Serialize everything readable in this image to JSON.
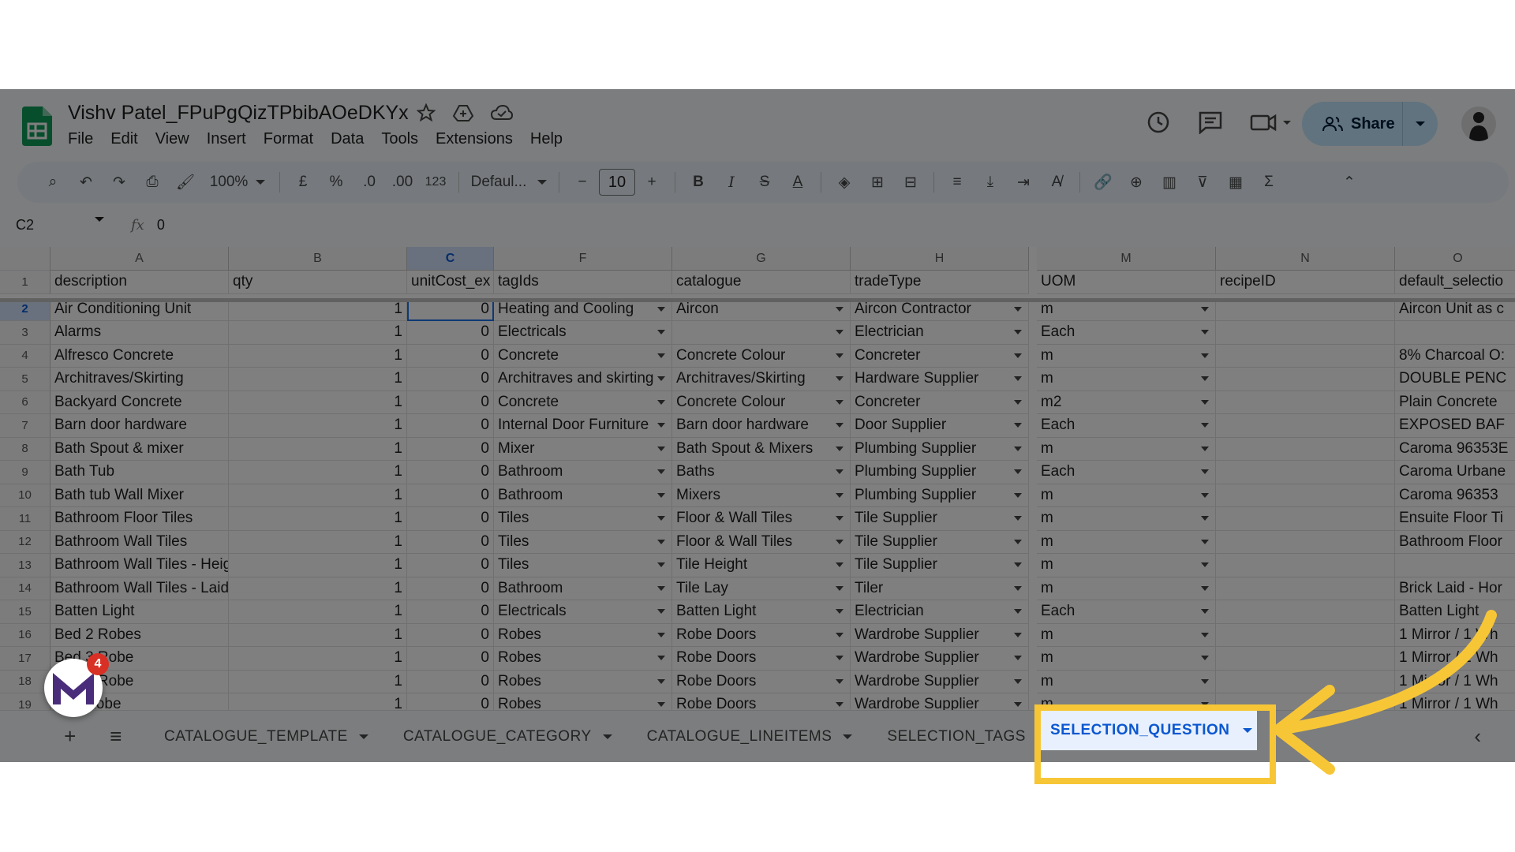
{
  "doc": {
    "title": "Vishv Patel_FPuPgQizTPbibAOeDKYx",
    "menu": [
      "File",
      "Edit",
      "View",
      "Insert",
      "Format",
      "Data",
      "Tools",
      "Extensions",
      "Help"
    ],
    "share_label": "Share"
  },
  "toolbar": {
    "zoom": "100%",
    "currency": "£",
    "percent": "%",
    "dec_decrease": ".0",
    "dec_increase": ".00",
    "number_format": "123",
    "font": "Defaul...",
    "font_size": "10"
  },
  "formula_bar": {
    "cell_ref": "C2",
    "fx": "fx",
    "value": "0"
  },
  "sheet": {
    "columns": [
      "A",
      "B",
      "C",
      "F",
      "G",
      "H",
      "M",
      "N",
      "O"
    ],
    "header_row": [
      "description",
      "qty",
      "unitCost_ex",
      "tagIds",
      "catalogue",
      "tradeType",
      "UOM",
      "recipeID",
      "default_selectio"
    ],
    "rows": [
      {
        "n": "2",
        "cells": [
          "Air Conditioning Unit",
          "1",
          "0",
          "Heating and Cooling",
          "Aircon",
          "Aircon Contractor",
          "m",
          "",
          "Aircon Unit as c"
        ]
      },
      {
        "n": "3",
        "cells": [
          "Alarms",
          "1",
          "0",
          "Electricals",
          "",
          "Electrician",
          "Each",
          "",
          ""
        ]
      },
      {
        "n": "4",
        "cells": [
          "Alfresco Concrete",
          "1",
          "0",
          "Concrete",
          "Concrete Colour",
          "Concreter",
          "m",
          "",
          "8% Charcoal O:"
        ]
      },
      {
        "n": "5",
        "cells": [
          "Architraves/Skirting",
          "1",
          "0",
          "Architraves and skirting",
          "Architraves/Skirting",
          "Hardware Supplier",
          "m",
          "",
          "DOUBLE PENC"
        ]
      },
      {
        "n": "6",
        "cells": [
          "Backyard Concrete",
          "1",
          "0",
          "Concrete",
          "Concrete Colour",
          "Concreter",
          "m2",
          "",
          "Plain Concrete"
        ]
      },
      {
        "n": "7",
        "cells": [
          "Barn door hardware",
          "1",
          "0",
          "Internal Door Furniture",
          "Barn door hardware",
          "Door Supplier",
          "Each",
          "",
          "EXPOSED BAF"
        ]
      },
      {
        "n": "8",
        "cells": [
          "Bath Spout & mixer",
          "1",
          "0",
          "Mixer",
          "Bath Spout & Mixers",
          "Plumbing Supplier",
          "m",
          "",
          "Caroma 96353E"
        ]
      },
      {
        "n": "9",
        "cells": [
          "Bath Tub",
          "1",
          "0",
          "Bathroom",
          "Baths",
          "Plumbing Supplier",
          "Each",
          "",
          "Caroma Urbane"
        ]
      },
      {
        "n": "10",
        "cells": [
          "Bath tub Wall Mixer",
          "1",
          "0",
          "Bathroom",
          "Mixers",
          "Plumbing Supplier",
          "m",
          "",
          " Caroma 96353"
        ]
      },
      {
        "n": "11",
        "cells": [
          "Bathroom Floor Tiles",
          "1",
          "0",
          "Tiles",
          "Floor & Wall Tiles",
          "Tile Supplier",
          "m",
          "",
          "Ensuite Floor Ti"
        ]
      },
      {
        "n": "12",
        "cells": [
          "Bathroom Wall Tiles",
          "1",
          "0",
          "Tiles",
          "Floor & Wall Tiles",
          "Tile Supplier",
          "m",
          "",
          "Bathroom Floor"
        ]
      },
      {
        "n": "13",
        "cells": [
          "Bathroom Wall Tiles - Heig",
          "1",
          "0",
          "Tiles",
          "Tile Height",
          "Tile Supplier",
          "m",
          "",
          ""
        ]
      },
      {
        "n": "14",
        "cells": [
          "Bathroom Wall Tiles - Laid",
          "1",
          "0",
          "Bathroom",
          "Tile Lay",
          "Tiler",
          "m",
          "",
          "Brick Laid - Hor"
        ]
      },
      {
        "n": "15",
        "cells": [
          "Batten Light",
          "1",
          "0",
          "Electricals",
          "Batten Light",
          "Electrician",
          "Each",
          "",
          "Batten Light"
        ]
      },
      {
        "n": "16",
        "cells": [
          "Bed 2 Robes",
          "1",
          "0",
          "Robes",
          "Robe Doors",
          "Wardrobe Supplier",
          "m",
          "",
          " 1 Mirror / 1 Wh"
        ]
      },
      {
        "n": "17",
        "cells": [
          "Bed 3 Robe",
          "1",
          "0",
          "Robes",
          "Robe Doors",
          "Wardrobe Supplier",
          "m",
          "",
          " 1 Mirror / 1 Wh"
        ]
      },
      {
        "n": "18",
        "cells": [
          "Bed 4 Robe",
          "1",
          "0",
          "Robes",
          "Robe Doors",
          "Wardrobe Supplier",
          "m",
          "",
          " 1 Mirror / 1 Wh"
        ]
      },
      {
        "n": "19",
        "cells": [
          "Bed Robe",
          "1",
          "0",
          "Robes",
          "Robe Doors",
          "Wardrobe Supplier",
          "m",
          "",
          " 1 Mirror / 1 Wh"
        ]
      }
    ]
  },
  "tabs": [
    "CATALOGUE_TEMPLATE",
    "CATALOGUE_CATEGORY",
    "CATALOGUE_LINEITEMS",
    "SELECTION_TAGS",
    "SELECTION_QUESTION"
  ],
  "badge": {
    "count": "4"
  },
  "colors": {
    "highlight": "#f7c636",
    "accent": "#0b57d0",
    "sheets_green": "#0f9d58"
  }
}
